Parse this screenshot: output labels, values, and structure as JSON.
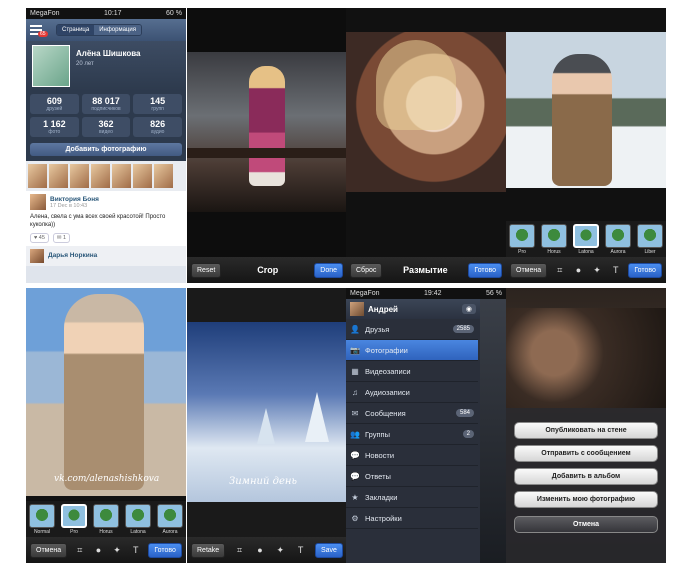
{
  "profile": {
    "carrier": "MegaFon",
    "time": "10:17",
    "battery": "60 %",
    "badge": "65",
    "tab_page": "Страница",
    "tab_info": "Информация",
    "name": "Алёна Шишкова",
    "age": "20 лет",
    "stats": [
      {
        "n": "609",
        "l": "друзей"
      },
      {
        "n": "88 017",
        "l": "подписчиков"
      },
      {
        "n": "145",
        "l": "групп"
      },
      {
        "n": "1 162",
        "l": "фото"
      },
      {
        "n": "362",
        "l": "видео"
      },
      {
        "n": "826",
        "l": "аудио"
      }
    ],
    "add_photo": "Добавить фотографию",
    "post_author": "Виктория Боня",
    "post_date": "17 Dec в 10:43",
    "post_text": "Алена, свела с ума всех своей красотой! Просто куколка))",
    "post_likes": "♥ 45",
    "post_comments": "✉ 1",
    "post2_author": "Дарья Норкина"
  },
  "crop": {
    "left": "Reset",
    "title": "Crop",
    "right": "Done"
  },
  "blur": {
    "left": "Сброс",
    "title": "Размытие",
    "right": "Готово"
  },
  "filters_top": {
    "left": "Отмена",
    "right": "Готово",
    "items": [
      "Pro",
      "Horus",
      "Latona",
      "Aurora",
      "Liber"
    ]
  },
  "filters_bottom": {
    "left": "Отмена",
    "right": "Готово",
    "watermark": "vk.com/alenashishkova",
    "items": [
      "Normal",
      "Pro",
      "Horus",
      "Latona",
      "Aurora"
    ]
  },
  "winter": {
    "left": "Retake",
    "right": "Save",
    "caption": "Зимний день"
  },
  "menu": {
    "carrier": "MegaFon",
    "time": "19:42",
    "battery": "56 %",
    "user": "Андрей",
    "items": [
      {
        "icon": "👤",
        "label": "Друзья",
        "badge": "2585"
      },
      {
        "icon": "📷",
        "label": "Фотографии",
        "badge": ""
      },
      {
        "icon": "▦",
        "label": "Видеозаписи",
        "badge": ""
      },
      {
        "icon": "♫",
        "label": "Аудиозаписи",
        "badge": ""
      },
      {
        "icon": "✉",
        "label": "Сообщения",
        "badge": "584"
      },
      {
        "icon": "👥",
        "label": "Группы",
        "badge": "2"
      },
      {
        "icon": "💬",
        "label": "Новости",
        "badge": ""
      },
      {
        "icon": "💬",
        "label": "Ответы",
        "badge": ""
      },
      {
        "icon": "★",
        "label": "Закладки",
        "badge": ""
      },
      {
        "icon": "⚙",
        "label": "Настройки",
        "badge": ""
      }
    ]
  },
  "sheet": {
    "buttons": [
      "Опубликовать на стене",
      "Отправить с сообщением",
      "Добавить в альбом",
      "Изменить мою фотографию"
    ],
    "cancel": "Отмена"
  }
}
